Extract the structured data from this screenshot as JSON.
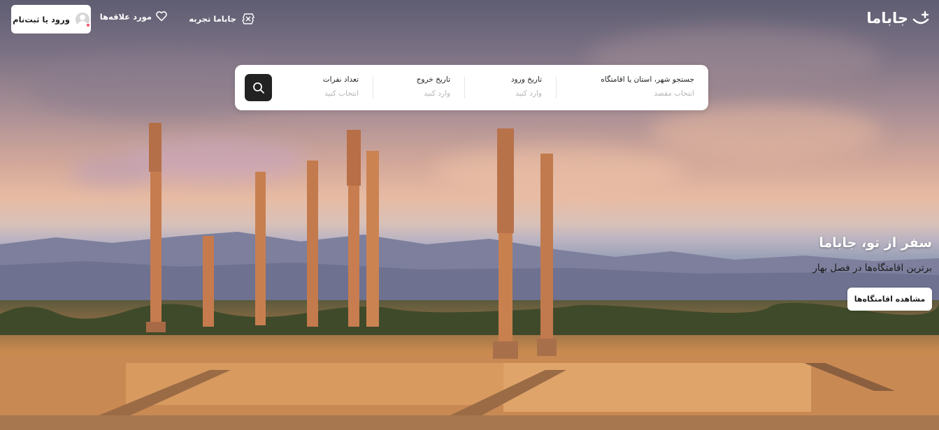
{
  "header": {
    "logo_text": "جاباما",
    "nav": {
      "experience_label": "جاباما تجربه",
      "favorites_label": "مورد علاقه‌ها"
    },
    "login_label": "ورود یا ثبت‌نام"
  },
  "search": {
    "destination": {
      "label": "جستجو شهر، استان یا اقامتگاه",
      "placeholder": "انتخاب مقصد"
    },
    "check_in": {
      "label": "تاریخ ورود",
      "placeholder": "وارد کنید"
    },
    "check_out": {
      "label": "تاریخ خروج",
      "placeholder": "وارد کنید"
    },
    "guests": {
      "label": "تعداد نفرات",
      "placeholder": "انتخاب کنید"
    }
  },
  "hero": {
    "title": "سفر از تو، جاباما",
    "subtitle": "برترین اقامتگاه‌ها در فصل بهار",
    "cta_label": "مشاهده اقامتگاه‌ها"
  },
  "colors": {
    "accent_dark": "#222222",
    "notification_dot": "#ff4d6a",
    "placeholder_gray": "#b4b4b4"
  }
}
